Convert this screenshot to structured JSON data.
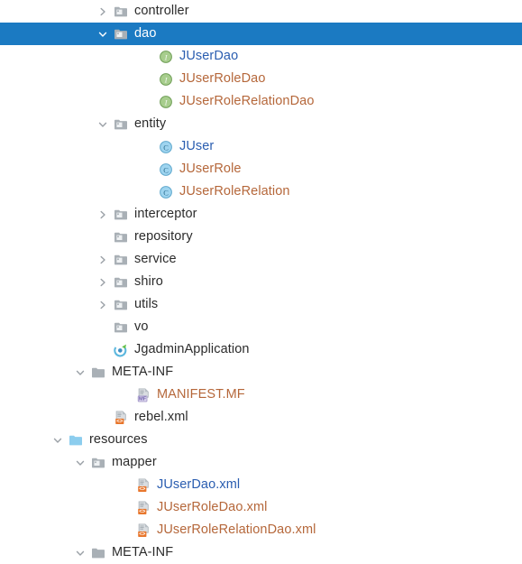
{
  "colors": {
    "selection_bg": "#1b7ac2",
    "selection_text": "#ffffff",
    "text_normal": "#2b2b2b",
    "text_added": "#2a5db0",
    "text_modified": "#b5673a",
    "folder_gray": "#a3aab0",
    "folder_cyan": "#87ccec",
    "badge_orange": "#e8762c",
    "badge_purple": "#9b8ec4",
    "interface_green": "#91c178",
    "class_blue": "#7fc2e8"
  },
  "tree": {
    "name": "project-tree",
    "rows": [
      {
        "label": "controller",
        "depth": 4,
        "twisty": "collapsed",
        "icon": "package-folder-icon",
        "color": "c-normal",
        "selected": false
      },
      {
        "label": "dao",
        "depth": 4,
        "twisty": "expanded",
        "icon": "package-folder-icon",
        "color": "c-normal",
        "selected": true
      },
      {
        "label": "JUserDao",
        "depth": 6,
        "twisty": "none",
        "icon": "interface-icon",
        "color": "c-added",
        "selected": false
      },
      {
        "label": "JUserRoleDao",
        "depth": 6,
        "twisty": "none",
        "icon": "interface-icon",
        "color": "c-modified",
        "selected": false
      },
      {
        "label": "JUserRoleRelationDao",
        "depth": 6,
        "twisty": "none",
        "icon": "interface-icon",
        "color": "c-modified",
        "selected": false
      },
      {
        "label": "entity",
        "depth": 4,
        "twisty": "expanded",
        "icon": "package-folder-icon",
        "color": "c-normal",
        "selected": false
      },
      {
        "label": "JUser",
        "depth": 6,
        "twisty": "none",
        "icon": "class-icon",
        "color": "c-added",
        "selected": false
      },
      {
        "label": "JUserRole",
        "depth": 6,
        "twisty": "none",
        "icon": "class-icon",
        "color": "c-modified",
        "selected": false
      },
      {
        "label": "JUserRoleRelation",
        "depth": 6,
        "twisty": "none",
        "icon": "class-icon",
        "color": "c-modified",
        "selected": false
      },
      {
        "label": "interceptor",
        "depth": 4,
        "twisty": "collapsed",
        "icon": "package-folder-icon",
        "color": "c-normal",
        "selected": false
      },
      {
        "label": "repository",
        "depth": 4,
        "twisty": "none",
        "icon": "package-folder-icon",
        "color": "c-normal",
        "selected": false
      },
      {
        "label": "service",
        "depth": 4,
        "twisty": "collapsed",
        "icon": "package-folder-icon",
        "color": "c-normal",
        "selected": false
      },
      {
        "label": "shiro",
        "depth": 4,
        "twisty": "collapsed",
        "icon": "package-folder-icon",
        "color": "c-normal",
        "selected": false
      },
      {
        "label": "utils",
        "depth": 4,
        "twisty": "collapsed",
        "icon": "package-folder-icon",
        "color": "c-normal",
        "selected": false
      },
      {
        "label": "vo",
        "depth": 4,
        "twisty": "none",
        "icon": "package-folder-icon",
        "color": "c-normal",
        "selected": false
      },
      {
        "label": "JgadminApplication",
        "depth": 4,
        "twisty": "none",
        "icon": "spring-boot-icon",
        "color": "c-normal",
        "selected": false
      },
      {
        "label": "META-INF",
        "depth": 3,
        "twisty": "expanded",
        "icon": "plain-folder-icon",
        "color": "c-normal",
        "selected": false
      },
      {
        "label": "MANIFEST.MF",
        "depth": 5,
        "twisty": "none",
        "icon": "manifest-icon",
        "color": "c-modified",
        "selected": false
      },
      {
        "label": "rebel.xml",
        "depth": 4,
        "twisty": "none",
        "icon": "xml-file-icon",
        "color": "c-normal",
        "selected": false
      },
      {
        "label": "resources",
        "depth": 2,
        "twisty": "expanded",
        "icon": "resources-folder-icon",
        "color": "c-normal",
        "selected": false
      },
      {
        "label": "mapper",
        "depth": 3,
        "twisty": "expanded",
        "icon": "package-folder-icon",
        "color": "c-normal",
        "selected": false
      },
      {
        "label": "JUserDao.xml",
        "depth": 5,
        "twisty": "none",
        "icon": "xml-file-icon",
        "color": "c-added",
        "selected": false
      },
      {
        "label": "JUserRoleDao.xml",
        "depth": 5,
        "twisty": "none",
        "icon": "xml-file-icon",
        "color": "c-modified",
        "selected": false
      },
      {
        "label": "JUserRoleRelationDao.xml",
        "depth": 5,
        "twisty": "none",
        "icon": "xml-file-icon",
        "color": "c-modified",
        "selected": false
      },
      {
        "label": "META-INF",
        "depth": 3,
        "twisty": "expanded",
        "icon": "plain-folder-icon",
        "color": "c-normal",
        "selected": false
      }
    ]
  }
}
